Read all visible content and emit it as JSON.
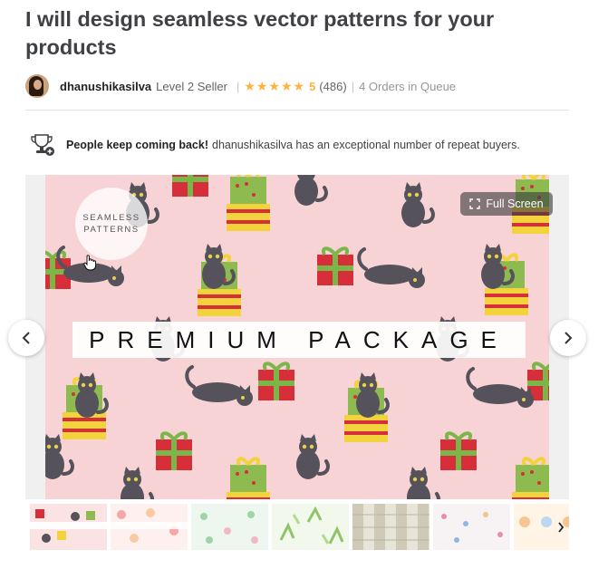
{
  "gig": {
    "title": "I will design seamless vector patterns for your products"
  },
  "seller": {
    "name": "dhanushikasilva",
    "level": "Level 2 Seller",
    "separator": "|",
    "stars": "★★★★★",
    "rating": "5",
    "reviews": "(486)",
    "queue": "4 Orders in Queue"
  },
  "repeat": {
    "strong": "People keep coming back!",
    "text": "dhanushikasilva has an exceptional number of repeat buyers."
  },
  "gallery": {
    "badge_line1": "SEAMLESS",
    "badge_line2": "PATTERNS",
    "banner": "PREMIUM PACKAGE",
    "fullscreen_label": "Full Screen",
    "pattern_bg": "#f8d3d6"
  },
  "icons": {
    "prev": "chevron-left-icon",
    "next": "chevron-right-icon",
    "fullscreen": "expand-icon",
    "trophy": "trophy-icon"
  }
}
